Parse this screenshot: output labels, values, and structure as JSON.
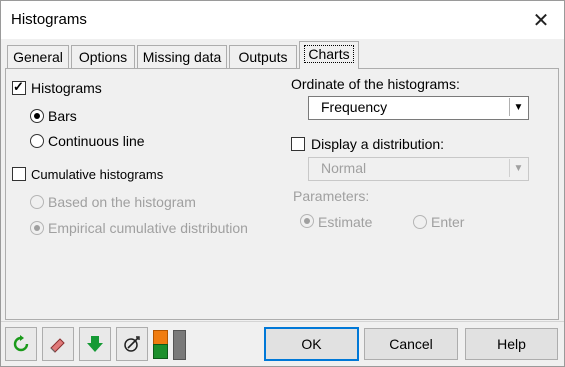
{
  "window": {
    "title": "Histograms"
  },
  "tabs": [
    {
      "label": "General"
    },
    {
      "label": "Options"
    },
    {
      "label": "Missing data"
    },
    {
      "label": "Outputs"
    },
    {
      "label": "Charts"
    }
  ],
  "left": {
    "histograms": {
      "label": "Histograms",
      "checked": true
    },
    "bars": {
      "label": "Bars",
      "selected": true
    },
    "continuous": {
      "label": "Continuous line",
      "selected": false
    },
    "cumulative": {
      "label": "Cumulative histograms",
      "checked": false
    },
    "based": {
      "label": "Based on the histogram",
      "selected": false,
      "enabled": false
    },
    "empirical": {
      "label": "Empirical cumulative distribution",
      "selected": true,
      "enabled": false
    }
  },
  "right": {
    "ordinate_label": "Ordinate of the histograms:",
    "ordinate_value": "Frequency",
    "display_dist": {
      "label": "Display a distribution:",
      "checked": false
    },
    "dist_value": "Normal",
    "parameters_label": "Parameters:",
    "estimate": {
      "label": "Estimate",
      "selected": true,
      "enabled": false
    },
    "enter": {
      "label": "Enter",
      "selected": false,
      "enabled": false
    }
  },
  "buttons": {
    "ok": "OK",
    "cancel": "Cancel",
    "help": "Help"
  },
  "toolbar": [
    "reset-icon",
    "eraser-icon",
    "download-icon",
    "select-data-icon",
    "layout-icon"
  ]
}
